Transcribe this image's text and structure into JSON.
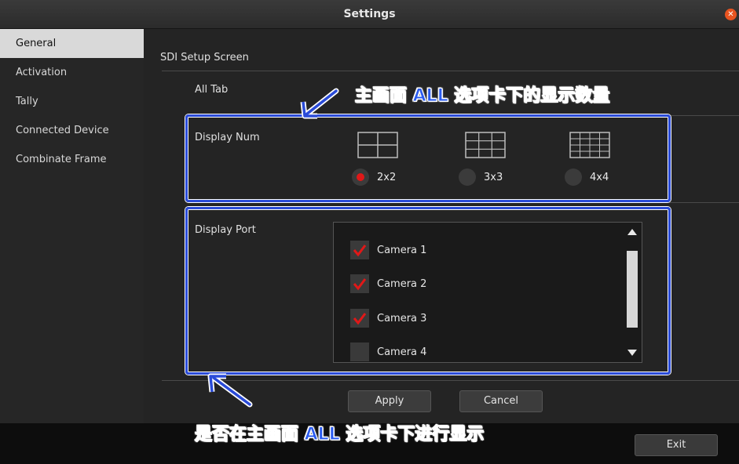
{
  "window": {
    "title": "Settings"
  },
  "sidebar": {
    "items": [
      {
        "label": "General",
        "active": true
      },
      {
        "label": "Activation"
      },
      {
        "label": "Tally"
      },
      {
        "label": "Connected Device"
      },
      {
        "label": "Combinate Frame"
      }
    ]
  },
  "main": {
    "section_title": "SDI Setup Screen",
    "all_tab_label": "All Tab",
    "display_num": {
      "label": "Display Num",
      "options": [
        {
          "label": "2x2",
          "selected": true
        },
        {
          "label": "3x3",
          "selected": false
        },
        {
          "label": "4x4",
          "selected": false
        }
      ]
    },
    "display_port": {
      "label": "Display Port",
      "cameras": [
        {
          "label": "Camera 1",
          "checked": true
        },
        {
          "label": "Camera 2",
          "checked": true
        },
        {
          "label": "Camera 3",
          "checked": true
        },
        {
          "label": "Camera 4",
          "checked": false
        }
      ]
    },
    "apply_label": "Apply",
    "cancel_label": "Cancel"
  },
  "footer": {
    "exit_label": "Exit"
  },
  "annotations": {
    "top": "主画面 ALL 选项卡下的显示数量",
    "bottom": "是否在主画面 ALL 选项卡下进行显示"
  },
  "colors": {
    "accent_blue": "#2a4bd8",
    "check_red": "#e01818",
    "close_orange": "#e95420"
  }
}
